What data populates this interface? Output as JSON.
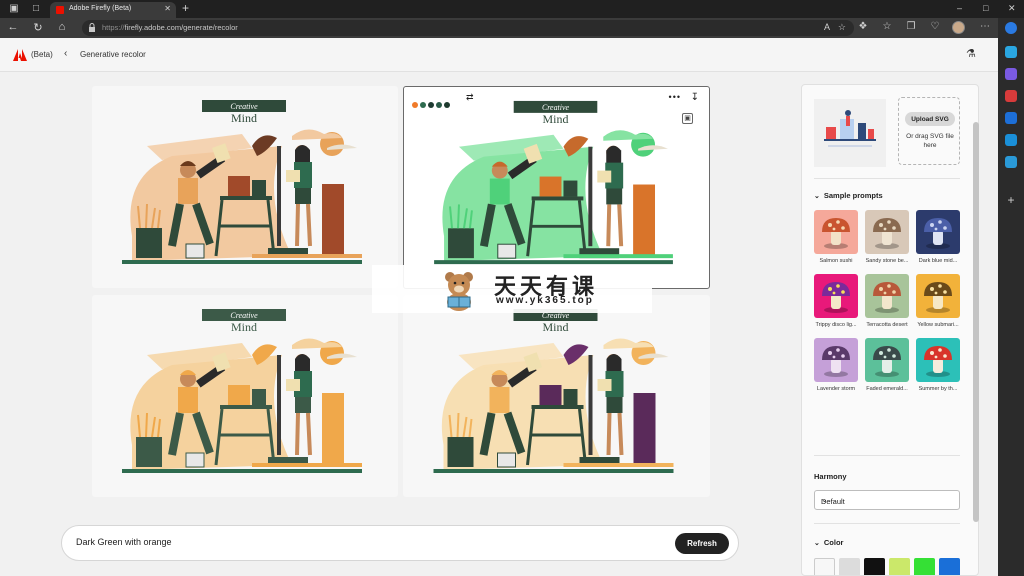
{
  "browser": {
    "tab_title": "Adobe Firefly (Beta)",
    "url_scheme": "https://",
    "url_rest": "firefly.adobe.com/generate/recolor"
  },
  "app": {
    "beta_label": "(Beta)",
    "breadcrumb": "Generative recolor"
  },
  "artwork": {
    "banner_word1": "Creative",
    "banner_word2": "Mind"
  },
  "variations": [
    {
      "palette": {
        "bg": "#f2c9a0",
        "accent": "#e8a35a",
        "dark": "#2f4a3a",
        "mid": "#a14a2a",
        "leaf": "#6c3b24",
        "rug": "#2e6b4f",
        "hair": "#6b3a1c"
      }
    },
    {
      "palette": {
        "bg": "#86e3a2",
        "accent": "#4fd17a",
        "dark": "#2f4a3a",
        "mid": "#d9742a",
        "leaf": "#c66a2c",
        "rug": "#2e6b4f",
        "hair": "#c66a2c"
      }
    },
    {
      "palette": {
        "bg": "#f5d29e",
        "accent": "#f0a84a",
        "dark": "#3c5a48",
        "mid": "#f0a84a",
        "leaf": "#f0a84a",
        "rug": "#2e6b4f",
        "hair": "#f0a84a"
      }
    },
    {
      "palette": {
        "bg": "#f7dfb3",
        "accent": "#f2b35c",
        "dark": "#2f4a3a",
        "mid": "#5a2a5a",
        "leaf": "#6a2f6a",
        "rug": "#2e6b4f",
        "hair": "#f2b35c"
      }
    }
  ],
  "card_dots": [
    "#f07b2a",
    "#2e6b4f",
    "#1f3b32",
    "#2a5a48",
    "#1e3a2e"
  ],
  "watermark": {
    "cn": "天天有课",
    "url": "www.yk365.top"
  },
  "prompt": {
    "value": "Dark Green with orange",
    "refresh_label": "Refresh"
  },
  "panel": {
    "upload_label": "Upload SVG",
    "drag_text": "Or drag SVG file here",
    "sample_prompts_title": "Sample prompts",
    "samples": [
      {
        "label": "Salmon sushi",
        "bg": "#f5a89a",
        "cap": "#c9542f",
        "spot": "#f5d7b0",
        "stem": "#f2e2c8"
      },
      {
        "label": "Sandy stone be...",
        "bg": "#d8c8b8",
        "cap": "#8a6a50",
        "spot": "#e8d8c0",
        "stem": "#efe4d2"
      },
      {
        "label": "Dark blue mid...",
        "bg": "#2c3b6c",
        "cap": "#4b5fa8",
        "spot": "#cbd4f0",
        "stem": "#dfe4f3"
      },
      {
        "label": "Trippy disco lig...",
        "bg": "#e8197a",
        "cap": "#7a2a9a",
        "spot": "#f8e05a",
        "stem": "#f4e9c8"
      },
      {
        "label": "Terracotta desert",
        "bg": "#a8c49a",
        "cap": "#b8583a",
        "spot": "#f0d4a8",
        "stem": "#f2e6cc"
      },
      {
        "label": "Yellow submari...",
        "bg": "#f2b23a",
        "cap": "#6a4a1a",
        "spot": "#f8e0a0",
        "stem": "#f6e8c6"
      },
      {
        "label": "Lavender storm",
        "bg": "#c5a0d8",
        "cap": "#5a3a6a",
        "spot": "#e8d0f0",
        "stem": "#efe2f2"
      },
      {
        "label": "Faded emerald...",
        "bg": "#5cc09a",
        "cap": "#3a4a4a",
        "spot": "#cfe8dc",
        "stem": "#e4efe8"
      },
      {
        "label": "Summer by th...",
        "bg": "#2cc0b8",
        "cap": "#d8342a",
        "spot": "#f8e8d0",
        "stem": "#f4ecdc"
      }
    ],
    "harmony_title": "Harmony",
    "harmony_value": "Default",
    "color_title": "Color",
    "swatches": [
      "#f7f7f7",
      "#dcdcdc",
      "#111111",
      "#cbe86a",
      "#35e035",
      "#1a6fd8",
      "#f0e8a8",
      "#e8e0b0",
      "#111111",
      "#cbe86a",
      "#35e035",
      "#1a6fd8"
    ]
  }
}
